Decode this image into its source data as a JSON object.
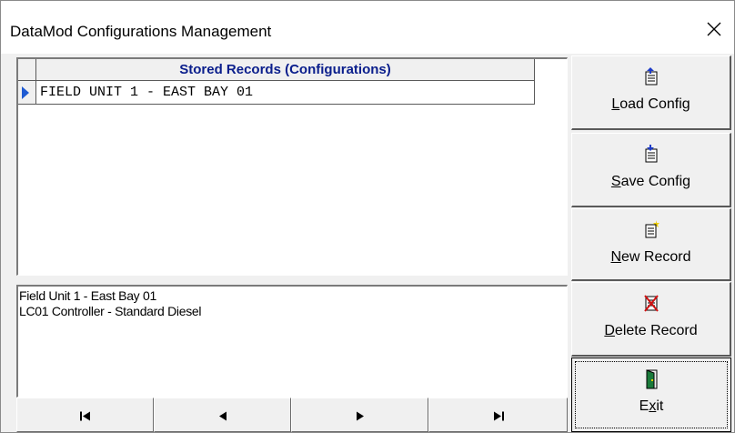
{
  "window": {
    "title": "DataMod Configurations Management",
    "close_glyph": "✕"
  },
  "grid": {
    "column_header": "Stored Records (Configurations)",
    "rows": [
      "FIELD UNIT 1 - EAST BAY 01"
    ]
  },
  "memo": {
    "lines": [
      "Field Unit 1 - East Bay 01",
      "LC01 Controller - Standard Diesel"
    ]
  },
  "navigator": {
    "icons": [
      "first-record-icon",
      "prior-record-icon",
      "next-record-icon",
      "last-record-icon"
    ]
  },
  "buttons": {
    "load": {
      "hotkey": "L",
      "rest": "oad Config",
      "icon": "load-config-icon"
    },
    "save": {
      "hotkey": "S",
      "rest": "ave Config",
      "icon": "save-config-icon"
    },
    "new": {
      "hotkey": "N",
      "rest": "ew Record",
      "icon": "new-record-icon"
    },
    "delete": {
      "hotkey": "D",
      "rest": "elete Record",
      "icon": "delete-record-icon"
    },
    "exit": {
      "pre": "E",
      "hotkey": "x",
      "rest": "it",
      "icon": "exit-door-icon"
    }
  },
  "colors": {
    "header_text": "#0a1e8c",
    "indicator": "#1e5ad2"
  }
}
